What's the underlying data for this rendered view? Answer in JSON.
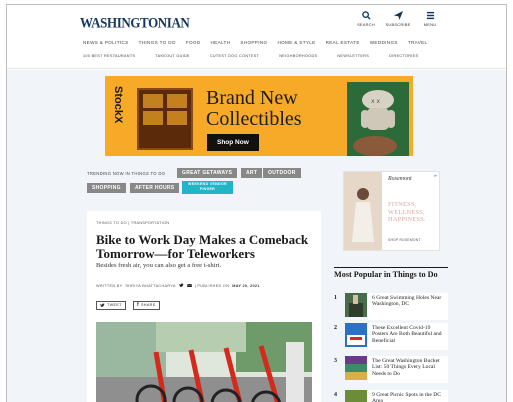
{
  "header": {
    "logo": "WASHINGTONIAN",
    "tools": [
      {
        "icon": "search-icon",
        "label": "SEARCH"
      },
      {
        "icon": "subscribe-icon",
        "label": "SUBSCRIBE"
      },
      {
        "icon": "menu-icon",
        "label": "MENU"
      }
    ],
    "nav_primary": [
      "NEWS & POLITICS",
      "THINGS TO DO",
      "FOOD",
      "HEALTH",
      "SHOPPING",
      "HOME & STYLE",
      "REAL ESTATE",
      "WEDDINGS",
      "TRAVEL"
    ],
    "nav_secondary": [
      "100 BEST RESTAURANTS",
      "TAKEOUT GUIDE",
      "CUTEST DOG CONTEST",
      "NEIGHBORHOODS",
      "NEWSLETTERS",
      "DIRECTORIES"
    ]
  },
  "ad_banner": {
    "brand": "StockX",
    "headline_line1": "Brand New",
    "headline_line2": "Collectibles",
    "cta": "Shop Now",
    "accent": "#f7a928"
  },
  "trending": {
    "label": "TRENDING NOW IN THINGS TO DO",
    "tags": [
      "GREAT GETAWAYS",
      "ART",
      "OUTDOOR",
      "SHOPPING",
      "AFTER HOURS"
    ],
    "highlight_line1": "WEEKEND VENDOR",
    "highlight_line2": "FINDER",
    "highlight_color": "#22b5c8"
  },
  "article": {
    "breadcrumb_section": "THINGS TO DO",
    "breadcrumb_sep": "|",
    "breadcrumb_sub": "TRANSPORTATION",
    "title": "Bike to Work Day Makes a Comeback Tomorrow—for Teleworkers",
    "dek": "Besides fresh air, you can also get a free t-shirt.",
    "byline_prefix": "WRITTEN BY",
    "author": "SHRIYA BHATTACHARYA",
    "published_prefix": "| PUBLISHED ON",
    "date": "MAY 20, 2021",
    "share_tweet": "TWEET",
    "share_facebook": "SHARE"
  },
  "sidebar_ad": {
    "brand": "Rosemont",
    "copy_line1": "FITNESS,",
    "copy_line2": "WELLNESS,",
    "copy_line3": "HAPPINESS.",
    "footer": "SHOP ROSEMONT"
  },
  "popular": {
    "title": "Most Popular in Things to Do",
    "items": [
      {
        "num": "1",
        "title": "6 Great Swimming Holes Near Washington, DC"
      },
      {
        "num": "2",
        "title": "These Excellent Covid-19 Posters Are Both Beautiful and Beneficial"
      },
      {
        "num": "3",
        "title": "The Great Washington Bucket List: 50 Things Every Local Needs to Do"
      },
      {
        "num": "4",
        "title": "9 Great Picnic Spots in the DC Area"
      }
    ]
  }
}
